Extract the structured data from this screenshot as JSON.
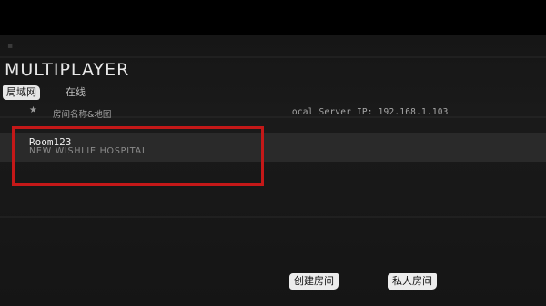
{
  "header": {
    "title": "MULTIPLAYER"
  },
  "tabs": [
    {
      "label": "局域网",
      "active": true
    },
    {
      "label": "在线",
      "active": false
    }
  ],
  "list": {
    "favorite_icon": "star-icon",
    "column_label": "房间名称&地图",
    "server_ip": "Local Server IP: 192.168.1.103",
    "rooms": [
      {
        "name": "Room123",
        "map": "NEW WISHLIE HOSPITAL"
      }
    ]
  },
  "actions": {
    "create_room": "创建房间",
    "private_room": "私人房间"
  },
  "colors": {
    "background": "#161616",
    "highlight_border": "#c41818",
    "button_bg": "#ececec"
  }
}
